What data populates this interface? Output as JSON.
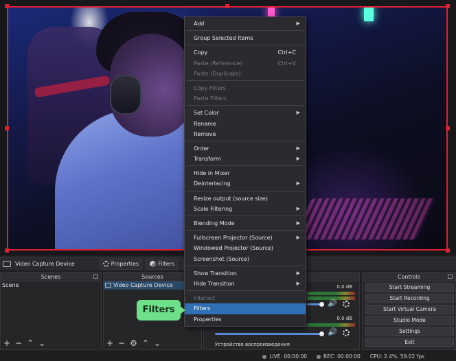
{
  "source_toolbar": {
    "source_name": "Video Capture Device",
    "properties_label": "Properties",
    "filters_label": "Filters",
    "partial_button": "De"
  },
  "scenes": {
    "title": "Scenes",
    "items": [
      "Scene"
    ]
  },
  "sources": {
    "title": "Sources",
    "items": [
      "Video Capture Device"
    ]
  },
  "mixer": {
    "channels": [
      {
        "db": "0.0 dB"
      },
      {
        "db": "0.0 dB",
        "name": "Устройство воспроизведения"
      }
    ]
  },
  "controls": {
    "title": "Controls",
    "buttons": [
      "Start Streaming",
      "Start Recording",
      "Start Virtual Camera",
      "Studio Mode",
      "Settings",
      "Exit"
    ]
  },
  "status": {
    "live": "LIVE: 00:00:00",
    "rec": "REC: 00:00:00",
    "cpu": "CPU: 2.4%, 59.02 fps"
  },
  "context_menu": {
    "add": "Add",
    "group": "Group Selected Items",
    "copy": "Copy",
    "copy_shortcut": "Ctrl+C",
    "paste_ref": "Paste (Reference)",
    "paste_ref_shortcut": "Ctrl+V",
    "paste_dup": "Paste (Duplicate)",
    "copy_filters": "Copy Filters",
    "paste_filters": "Paste Filters",
    "set_color": "Set Color",
    "rename": "Rename",
    "remove": "Remove",
    "order": "Order",
    "transform": "Transform",
    "hide_mixer": "Hide in Mixer",
    "deinterlacing": "Deinterlacing",
    "resize_output": "Resize output (source size)",
    "scale_filtering": "Scale Filtering",
    "blending_mode": "Blending Mode",
    "fullscreen_projector": "Fullscreen Projector (Source)",
    "windowed_projector": "Windowed Projector (Source)",
    "screenshot": "Screenshot (Source)",
    "show_transition": "Show Transition",
    "hide_transition": "Hide Transition",
    "interact": "Interact",
    "filters": "Filters",
    "properties": "Properties"
  },
  "callout": {
    "label": "Filters",
    "color": "#6fe08a"
  },
  "colors": {
    "selection": "#e02030",
    "highlight": "#2f6fb3"
  }
}
